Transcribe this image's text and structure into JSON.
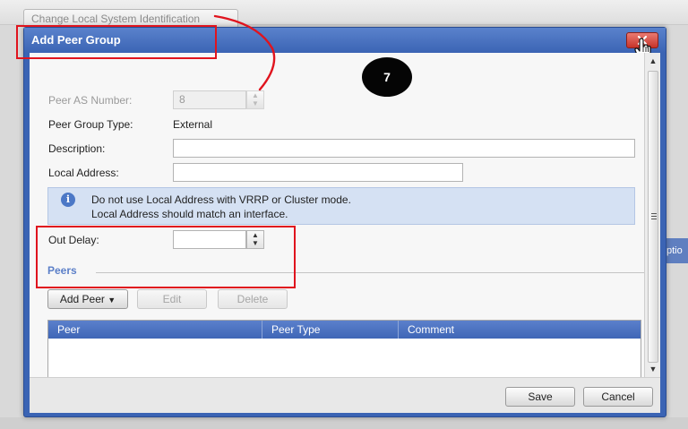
{
  "background": {
    "top_button_label": "Change Local System Identification",
    "right_tab_label": "ptio"
  },
  "dialog": {
    "title": "Add Peer Group",
    "fields": {
      "peer_as_number": {
        "label": "Peer AS Number:",
        "value": "8"
      },
      "peer_group_type": {
        "label": "Peer Group Type:",
        "value": "External"
      },
      "description": {
        "label": "Description:",
        "value": ""
      },
      "local_address": {
        "label": "Local Address:",
        "value": ""
      },
      "out_delay": {
        "label": "Out Delay:",
        "value": ""
      }
    },
    "info": {
      "line1": "Do not use Local Address with VRRP or Cluster mode.",
      "line2": "Local Address should match an interface."
    },
    "peers": {
      "section_title": "Peers",
      "add_peer_label": "Add Peer",
      "edit_label": "Edit",
      "delete_label": "Delete",
      "columns": [
        "Peer",
        "Peer Type",
        "Comment"
      ]
    },
    "footer": {
      "save_label": "Save",
      "cancel_label": "Cancel"
    }
  },
  "annotation": {
    "step_number": "7",
    "color": "#e0141e"
  }
}
